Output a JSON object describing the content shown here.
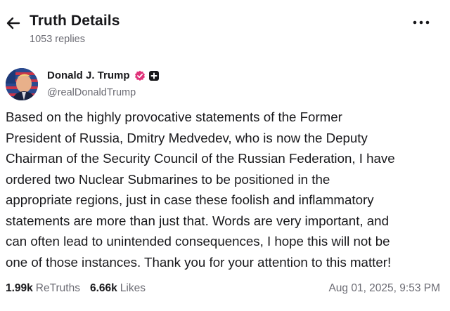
{
  "header": {
    "back_icon": "arrow-left-icon",
    "title": "Truth Details",
    "replies": "1053 replies",
    "more_icon": "more-horizontal-icon"
  },
  "post": {
    "author_name": "Donald J. Trump",
    "verified_icon": "verified-badge-icon",
    "plus_icon": "plus-badge-icon",
    "handle": "@realDonaldTrump",
    "text": "Based on the highly provocative statements of the Former\nPresident of Russia, Dmitry Medvedev, who is now the Deputy\nChairman of the Security Council of the Russian Federation, I have\nordered two Nuclear Submarines to be positioned in the\nappropriate regions, just in case these foolish and inflammatory\nstatements are more than just that. Words are very important, and\ncan often lead to unintended consequences, I hope this will not be\none of those instances. Thank you for your attention to this matter!",
    "retruths_count": "1.99k",
    "retruths_label": "ReTruths",
    "likes_count": "6.66k",
    "likes_label": "Likes",
    "timestamp": "Aug 01, 2025, 9:53 PM"
  },
  "colors": {
    "text": "#18181b",
    "muted": "#6b6b73",
    "verified": "#e0337a"
  }
}
